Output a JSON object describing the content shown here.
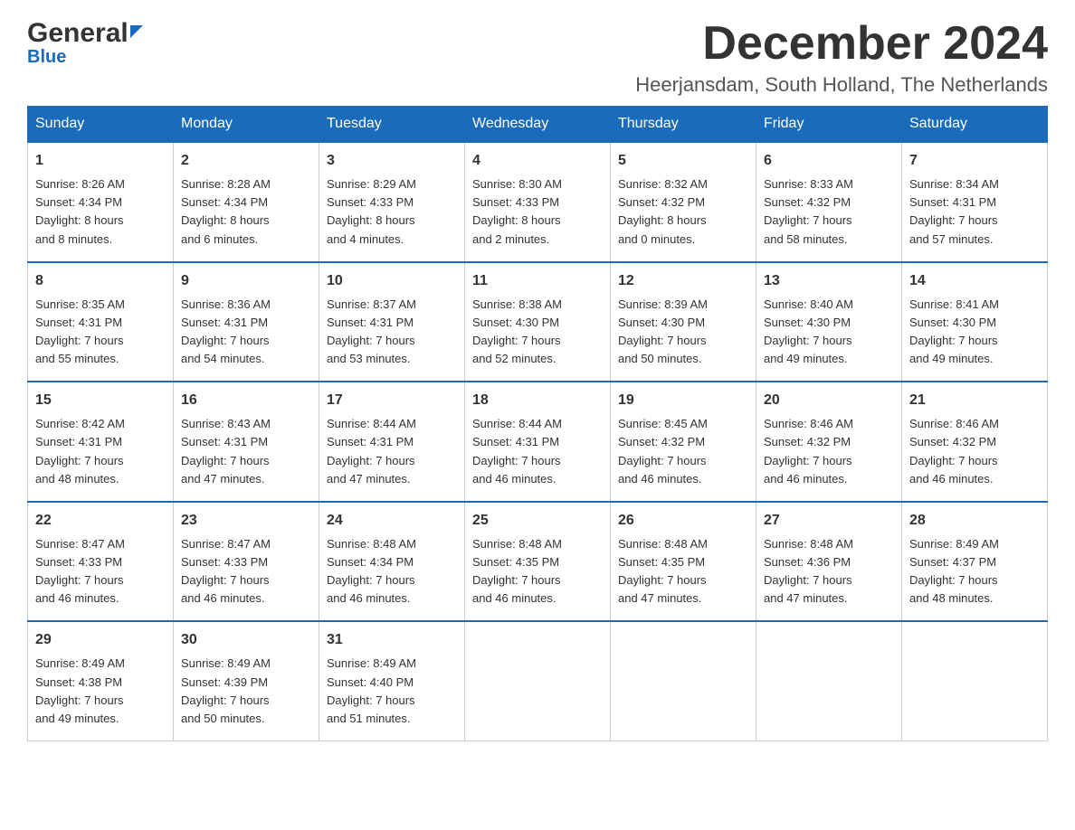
{
  "logo": {
    "line1": "General",
    "line2": "Blue"
  },
  "header": {
    "month_year": "December 2024",
    "location": "Heerjansdam, South Holland, The Netherlands"
  },
  "days_of_week": [
    "Sunday",
    "Monday",
    "Tuesday",
    "Wednesday",
    "Thursday",
    "Friday",
    "Saturday"
  ],
  "weeks": [
    [
      {
        "day": "1",
        "sunrise": "8:26 AM",
        "sunset": "4:34 PM",
        "daylight": "8 hours and 8 minutes."
      },
      {
        "day": "2",
        "sunrise": "8:28 AM",
        "sunset": "4:34 PM",
        "daylight": "8 hours and 6 minutes."
      },
      {
        "day": "3",
        "sunrise": "8:29 AM",
        "sunset": "4:33 PM",
        "daylight": "8 hours and 4 minutes."
      },
      {
        "day": "4",
        "sunrise": "8:30 AM",
        "sunset": "4:33 PM",
        "daylight": "8 hours and 2 minutes."
      },
      {
        "day": "5",
        "sunrise": "8:32 AM",
        "sunset": "4:32 PM",
        "daylight": "8 hours and 0 minutes."
      },
      {
        "day": "6",
        "sunrise": "8:33 AM",
        "sunset": "4:32 PM",
        "daylight": "7 hours and 58 minutes."
      },
      {
        "day": "7",
        "sunrise": "8:34 AM",
        "sunset": "4:31 PM",
        "daylight": "7 hours and 57 minutes."
      }
    ],
    [
      {
        "day": "8",
        "sunrise": "8:35 AM",
        "sunset": "4:31 PM",
        "daylight": "7 hours and 55 minutes."
      },
      {
        "day": "9",
        "sunrise": "8:36 AM",
        "sunset": "4:31 PM",
        "daylight": "7 hours and 54 minutes."
      },
      {
        "day": "10",
        "sunrise": "8:37 AM",
        "sunset": "4:31 PM",
        "daylight": "7 hours and 53 minutes."
      },
      {
        "day": "11",
        "sunrise": "8:38 AM",
        "sunset": "4:30 PM",
        "daylight": "7 hours and 52 minutes."
      },
      {
        "day": "12",
        "sunrise": "8:39 AM",
        "sunset": "4:30 PM",
        "daylight": "7 hours and 50 minutes."
      },
      {
        "day": "13",
        "sunrise": "8:40 AM",
        "sunset": "4:30 PM",
        "daylight": "7 hours and 49 minutes."
      },
      {
        "day": "14",
        "sunrise": "8:41 AM",
        "sunset": "4:30 PM",
        "daylight": "7 hours and 49 minutes."
      }
    ],
    [
      {
        "day": "15",
        "sunrise": "8:42 AM",
        "sunset": "4:31 PM",
        "daylight": "7 hours and 48 minutes."
      },
      {
        "day": "16",
        "sunrise": "8:43 AM",
        "sunset": "4:31 PM",
        "daylight": "7 hours and 47 minutes."
      },
      {
        "day": "17",
        "sunrise": "8:44 AM",
        "sunset": "4:31 PM",
        "daylight": "7 hours and 47 minutes."
      },
      {
        "day": "18",
        "sunrise": "8:44 AM",
        "sunset": "4:31 PM",
        "daylight": "7 hours and 46 minutes."
      },
      {
        "day": "19",
        "sunrise": "8:45 AM",
        "sunset": "4:32 PM",
        "daylight": "7 hours and 46 minutes."
      },
      {
        "day": "20",
        "sunrise": "8:46 AM",
        "sunset": "4:32 PM",
        "daylight": "7 hours and 46 minutes."
      },
      {
        "day": "21",
        "sunrise": "8:46 AM",
        "sunset": "4:32 PM",
        "daylight": "7 hours and 46 minutes."
      }
    ],
    [
      {
        "day": "22",
        "sunrise": "8:47 AM",
        "sunset": "4:33 PM",
        "daylight": "7 hours and 46 minutes."
      },
      {
        "day": "23",
        "sunrise": "8:47 AM",
        "sunset": "4:33 PM",
        "daylight": "7 hours and 46 minutes."
      },
      {
        "day": "24",
        "sunrise": "8:48 AM",
        "sunset": "4:34 PM",
        "daylight": "7 hours and 46 minutes."
      },
      {
        "day": "25",
        "sunrise": "8:48 AM",
        "sunset": "4:35 PM",
        "daylight": "7 hours and 46 minutes."
      },
      {
        "day": "26",
        "sunrise": "8:48 AM",
        "sunset": "4:35 PM",
        "daylight": "7 hours and 47 minutes."
      },
      {
        "day": "27",
        "sunrise": "8:48 AM",
        "sunset": "4:36 PM",
        "daylight": "7 hours and 47 minutes."
      },
      {
        "day": "28",
        "sunrise": "8:49 AM",
        "sunset": "4:37 PM",
        "daylight": "7 hours and 48 minutes."
      }
    ],
    [
      {
        "day": "29",
        "sunrise": "8:49 AM",
        "sunset": "4:38 PM",
        "daylight": "7 hours and 49 minutes."
      },
      {
        "day": "30",
        "sunrise": "8:49 AM",
        "sunset": "4:39 PM",
        "daylight": "7 hours and 50 minutes."
      },
      {
        "day": "31",
        "sunrise": "8:49 AM",
        "sunset": "4:40 PM",
        "daylight": "7 hours and 51 minutes."
      },
      null,
      null,
      null,
      null
    ]
  ],
  "labels": {
    "sunrise": "Sunrise:",
    "sunset": "Sunset:",
    "daylight": "Daylight:"
  },
  "colors": {
    "header_bg": "#1a6bba",
    "header_text": "#ffffff",
    "border_accent": "#1a6bba",
    "row_border": "#1a6bba",
    "cell_border": "#cccccc"
  }
}
